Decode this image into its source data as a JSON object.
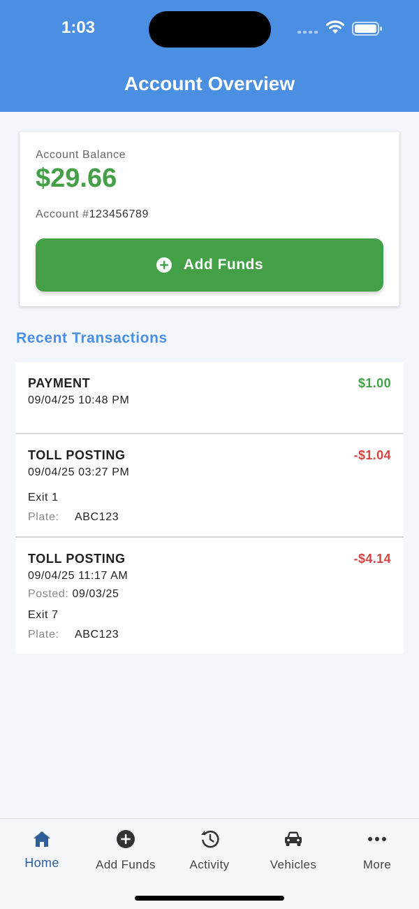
{
  "status_bar": {
    "time": "1:03"
  },
  "header": {
    "title": "Account Overview"
  },
  "balance_card": {
    "label": "Account Balance",
    "amount": "$29.66",
    "account_prefix": "Account #",
    "account_number": "123456789",
    "add_funds_label": "Add Funds"
  },
  "section": {
    "recent_title": "Recent Transactions"
  },
  "transactions": [
    {
      "type": "PAYMENT",
      "date": "09/04/25 10:48 PM",
      "amount": "$1.00",
      "amount_color": "#43a047"
    },
    {
      "type": "TOLL POSTING",
      "date": "09/04/25 03:27 PM",
      "amount": "-$1.04",
      "amount_color": "#d84343",
      "location": "Exit 1",
      "plate_label": "Plate:",
      "plate": "ABC123"
    },
    {
      "type": "TOLL POSTING",
      "date": "09/04/25 11:17 AM",
      "amount": "-$4.14",
      "amount_color": "#d84343",
      "posted_label": "Posted:",
      "posted": "09/03/25",
      "location": "Exit 7",
      "plate_label": "Plate:",
      "plate": "ABC123"
    }
  ],
  "nav": {
    "items": [
      {
        "label": "Home",
        "icon": "home-icon",
        "active": true
      },
      {
        "label": "Add Funds",
        "icon": "plus-circle-icon"
      },
      {
        "label": "Activity",
        "icon": "history-icon"
      },
      {
        "label": "Vehicles",
        "icon": "car-icon"
      },
      {
        "label": "More",
        "icon": "more-icon"
      }
    ]
  },
  "colors": {
    "header": "#4a8fe2",
    "positive": "#43a047",
    "negative": "#d84343",
    "nav_active": "#2f5f9a"
  }
}
